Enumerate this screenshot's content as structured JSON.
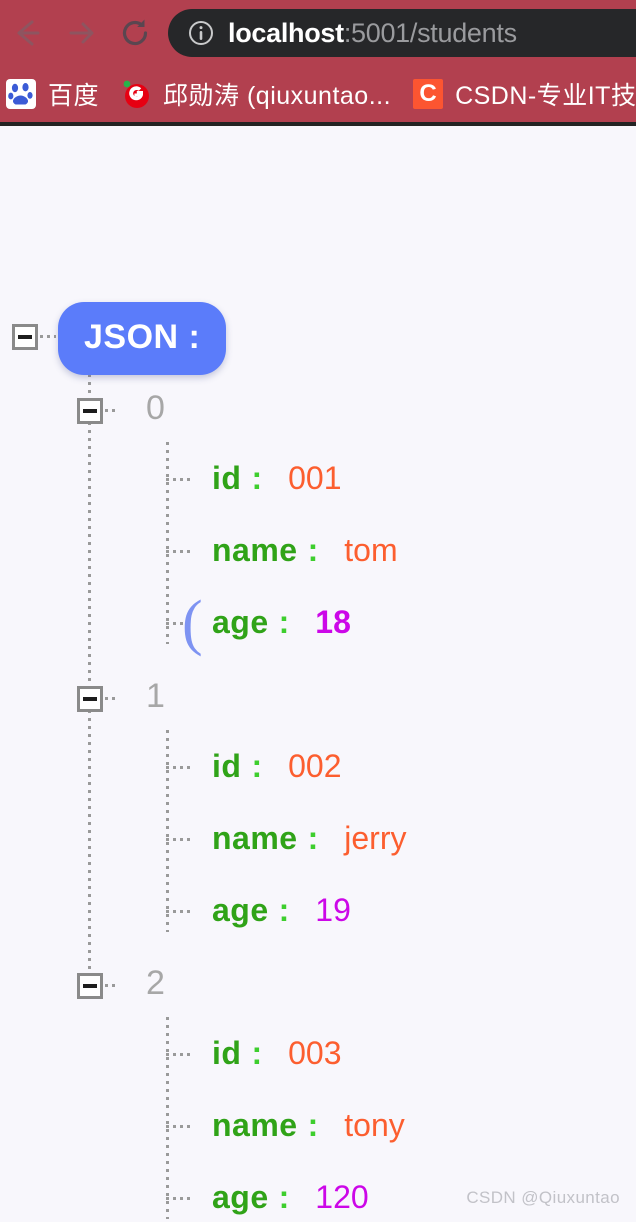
{
  "browser": {
    "nav": {
      "back": "back-arrow",
      "forward": "forward-arrow",
      "reload": "reload-icon"
    },
    "omnibox": {
      "info_icon": "info-circle-icon",
      "url_host": "localhost",
      "url_rest": ":5001/students",
      "full_url": "localhost:5001/students"
    },
    "bookmarks": [
      {
        "icon": "baidu-icon",
        "label": "百度"
      },
      {
        "icon": "google-icon",
        "label": "邱勋涛 (qiuxuntao..."
      },
      {
        "icon": "csdn-icon",
        "label": "CSDN-专业IT技",
        "icon_text": "C"
      }
    ]
  },
  "viewer": {
    "root_label": "JSON :",
    "toggle_glyph": "minus",
    "nodes": [
      {
        "index": "0",
        "fields": [
          {
            "key": "id",
            "colon": ":",
            "value": "001",
            "type": "str"
          },
          {
            "key": "name",
            "colon": ":",
            "value": "tom",
            "type": "str"
          },
          {
            "key": "age",
            "colon": ":",
            "value": "18",
            "type": "num"
          }
        ]
      },
      {
        "index": "1",
        "fields": [
          {
            "key": "id",
            "colon": ":",
            "value": "002",
            "type": "str"
          },
          {
            "key": "name",
            "colon": ":",
            "value": "jerry",
            "type": "str"
          },
          {
            "key": "age",
            "colon": ":",
            "value": "19",
            "type": "num"
          }
        ]
      },
      {
        "index": "2",
        "fields": [
          {
            "key": "id",
            "colon": ":",
            "value": "003",
            "type": "str"
          },
          {
            "key": "name",
            "colon": ":",
            "value": "tony",
            "type": "str"
          },
          {
            "key": "age",
            "colon": ":",
            "value": "120",
            "type": "num"
          }
        ]
      }
    ],
    "caret": "("
  },
  "watermark": "CSDN @Qiuxuntao",
  "colors": {
    "chrome_bg": "#b2404f",
    "omnibox_bg": "#262729",
    "page_bg": "#f8f7fc",
    "badge": "#5b7cfa",
    "key_green": "#30a318",
    "colon_green": "#3ece2e",
    "string_orange": "#fc5e2f",
    "number_magenta": "#cc07e8",
    "index_gray": "#a7a7a7",
    "caret_blue": "#7e93f2"
  }
}
